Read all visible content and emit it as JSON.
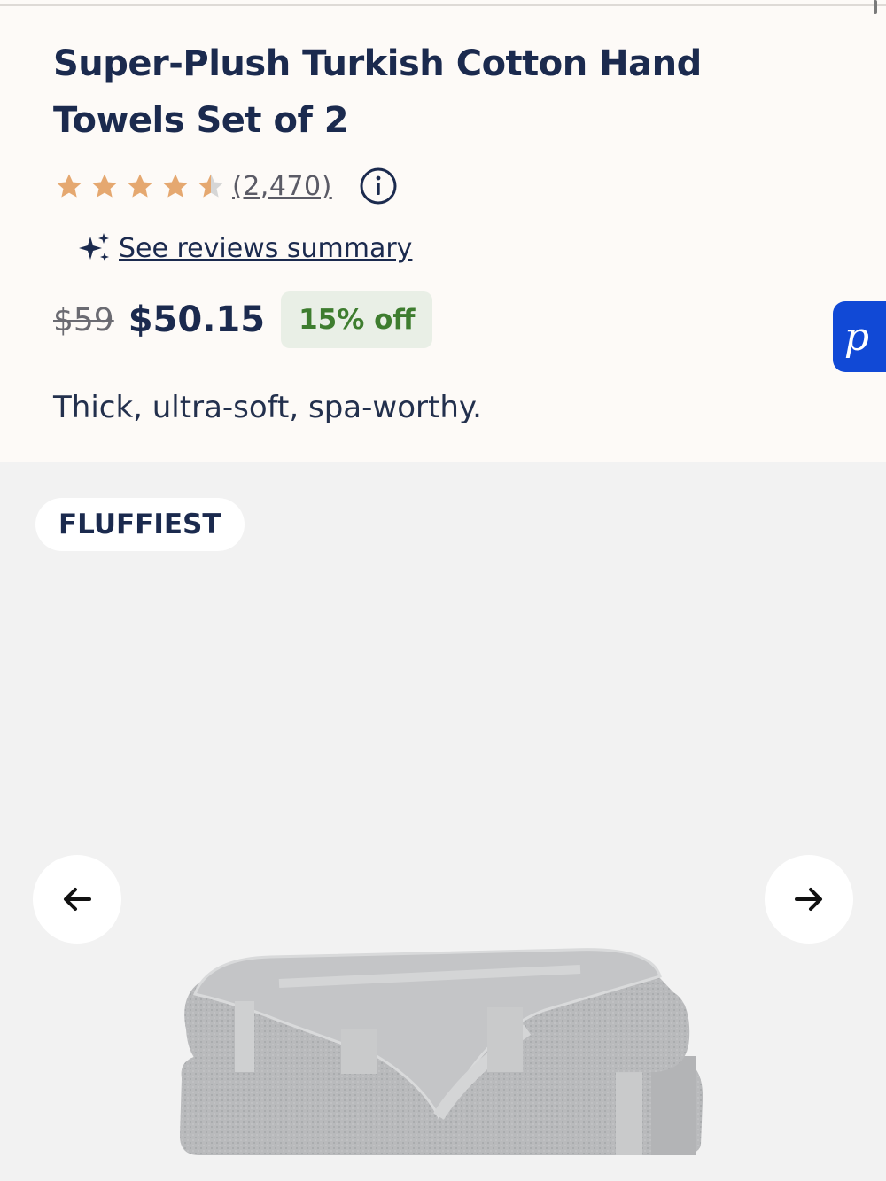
{
  "product": {
    "title": "Super-Plush Turkish Cotton Hand Towels Set of 2",
    "rating": 4.5,
    "rating_max": 5,
    "review_count": "(2,470)",
    "reviews_summary_link": "See reviews summary",
    "original_price": "$59",
    "sale_price": "$50.15",
    "discount": "15% off",
    "tagline": "Thick, ultra-soft, spa-worthy."
  },
  "floating_button": {
    "label": "p",
    "color": "#1149d6"
  },
  "gallery": {
    "badge": "FLUFFIEST",
    "prev_icon": "arrow-left-icon",
    "next_icon": "arrow-right-icon",
    "image": "gray-folded-towels"
  },
  "colors": {
    "star": "#e5a870",
    "title": "#1b2a4e",
    "discount_text": "#3e7d2f",
    "discount_bg": "#e9efe6",
    "top_bg": "#fdfaf7",
    "gallery_bg": "#f2f2f2"
  },
  "icons": {
    "star": "star-icon",
    "info": "info-icon",
    "sparkle": "sparkle-icon"
  }
}
